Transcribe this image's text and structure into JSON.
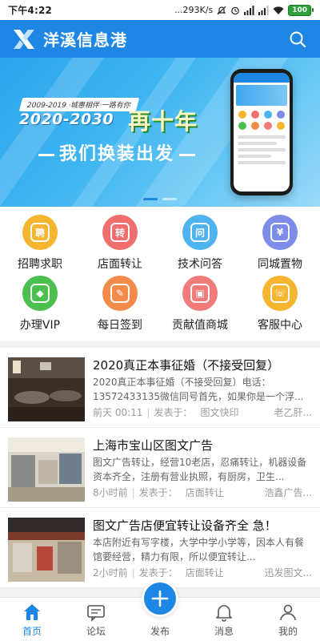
{
  "status_bar": {
    "time": "下午4:22",
    "speed": "...293K/s",
    "battery": "100"
  },
  "header": {
    "app_title": "洋溪信息港",
    "logo_icon": "x-logo-icon",
    "search_icon": "search-icon"
  },
  "banner": {
    "tagline": "2009-2019 ·城惠相伴·一路有你",
    "years": "2020-2030",
    "headline": "再十年",
    "slogan": "我们换装出发",
    "dots": 2,
    "active_dot": 1
  },
  "quick_links": [
    {
      "label": "招聘求职",
      "icon": "recruit-icon",
      "glyph": "聘",
      "color": "#f5b52e"
    },
    {
      "label": "店面转让",
      "icon": "shop-transfer-icon",
      "glyph": "转",
      "color": "#ef6f6f"
    },
    {
      "label": "技术问答",
      "icon": "question-icon",
      "glyph": "问",
      "color": "#4fb3ef"
    },
    {
      "label": "同城置物",
      "icon": "yuan-icon",
      "glyph": "¥",
      "color": "#7d8ce8"
    },
    {
      "label": "办理VIP",
      "icon": "vip-diamond-icon",
      "glyph": "◆",
      "color": "#4cc04e"
    },
    {
      "label": "每日签到",
      "icon": "checkin-icon",
      "glyph": "✎",
      "color": "#f28b4a"
    },
    {
      "label": "贡献值商城",
      "icon": "store-icon",
      "glyph": "▣",
      "color": "#f07b7b"
    },
    {
      "label": "客服中心",
      "icon": "headset-icon",
      "glyph": "☏",
      "color": "#f5b52e"
    }
  ],
  "posts": [
    {
      "title": "2020真正本事征婚（不接受回复）",
      "summary": "2020真正本事征婚（不接受回复）电话：13572433135微信同号首先，如果你是一个浮...",
      "time": "前天 00:11",
      "posted_in": "发表于：",
      "forum": "图文快印",
      "author": "老乙肝..."
    },
    {
      "title": "上海市宝山区图文广告",
      "summary": "图文广告转让，经营10老店，忍痛转让，机器设备资本齐全，注册有营业执照，有厨房，卫生...",
      "time": "8小时前",
      "posted_in": "发表于：",
      "forum": "店面转让",
      "author": "浩鑫广告..."
    },
    {
      "title": "图文广告店便宜转让设备齐全 急！",
      "summary": "本店附近有写字楼，大学中学小学等，因本人有餐馆要经营，精力有限，所以便宜转让...",
      "time": "2小时前",
      "posted_in": "发表于：",
      "forum": "店面转让",
      "author": "迅发图文..."
    }
  ],
  "tabbar": [
    {
      "label": "首页",
      "icon": "home-icon",
      "active": true
    },
    {
      "label": "论坛",
      "icon": "forum-chat-icon",
      "active": false
    },
    {
      "label": "发布",
      "icon": "plus-icon",
      "active": false
    },
    {
      "label": "消息",
      "icon": "bell-icon",
      "active": false
    },
    {
      "label": "我的",
      "icon": "person-icon",
      "active": false
    }
  ],
  "colors": {
    "primary": "#1e87e5",
    "background": "#f2f2f2"
  }
}
